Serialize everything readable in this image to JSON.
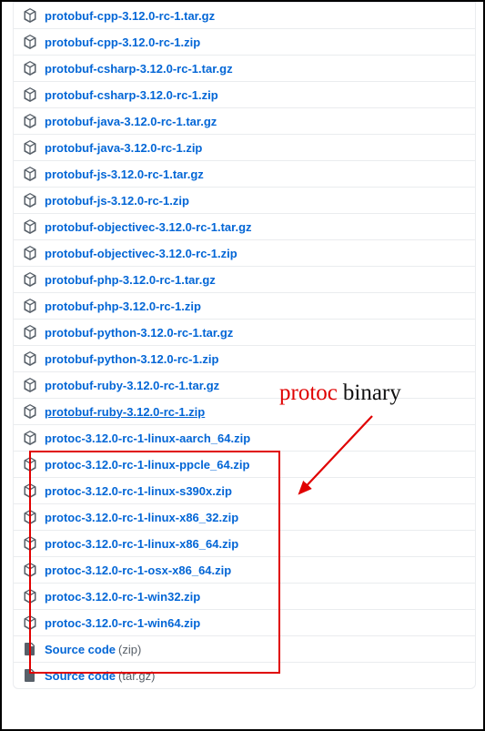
{
  "assets": [
    {
      "name": "protobuf-cpp-3.12.0-rc-1.tar.gz",
      "type": "pkg",
      "underlined": false
    },
    {
      "name": "protobuf-cpp-3.12.0-rc-1.zip",
      "type": "pkg",
      "underlined": false
    },
    {
      "name": "protobuf-csharp-3.12.0-rc-1.tar.gz",
      "type": "pkg",
      "underlined": false
    },
    {
      "name": "protobuf-csharp-3.12.0-rc-1.zip",
      "type": "pkg",
      "underlined": false
    },
    {
      "name": "protobuf-java-3.12.0-rc-1.tar.gz",
      "type": "pkg",
      "underlined": false
    },
    {
      "name": "protobuf-java-3.12.0-rc-1.zip",
      "type": "pkg",
      "underlined": false
    },
    {
      "name": "protobuf-js-3.12.0-rc-1.tar.gz",
      "type": "pkg",
      "underlined": false
    },
    {
      "name": "protobuf-js-3.12.0-rc-1.zip",
      "type": "pkg",
      "underlined": false
    },
    {
      "name": "protobuf-objectivec-3.12.0-rc-1.tar.gz",
      "type": "pkg",
      "underlined": false
    },
    {
      "name": "protobuf-objectivec-3.12.0-rc-1.zip",
      "type": "pkg",
      "underlined": false
    },
    {
      "name": "protobuf-php-3.12.0-rc-1.tar.gz",
      "type": "pkg",
      "underlined": false
    },
    {
      "name": "protobuf-php-3.12.0-rc-1.zip",
      "type": "pkg",
      "underlined": false
    },
    {
      "name": "protobuf-python-3.12.0-rc-1.tar.gz",
      "type": "pkg",
      "underlined": false
    },
    {
      "name": "protobuf-python-3.12.0-rc-1.zip",
      "type": "pkg",
      "underlined": false
    },
    {
      "name": "protobuf-ruby-3.12.0-rc-1.tar.gz",
      "type": "pkg",
      "underlined": false
    },
    {
      "name": "protobuf-ruby-3.12.0-rc-1.zip",
      "type": "pkg",
      "underlined": true
    },
    {
      "name": "protoc-3.12.0-rc-1-linux-aarch_64.zip",
      "type": "pkg",
      "underlined": false
    },
    {
      "name": "protoc-3.12.0-rc-1-linux-ppcle_64.zip",
      "type": "pkg",
      "underlined": false
    },
    {
      "name": "protoc-3.12.0-rc-1-linux-s390x.zip",
      "type": "pkg",
      "underlined": false
    },
    {
      "name": "protoc-3.12.0-rc-1-linux-x86_32.zip",
      "type": "pkg",
      "underlined": false
    },
    {
      "name": "protoc-3.12.0-rc-1-linux-x86_64.zip",
      "type": "pkg",
      "underlined": false
    },
    {
      "name": "protoc-3.12.0-rc-1-osx-x86_64.zip",
      "type": "pkg",
      "underlined": false
    },
    {
      "name": "protoc-3.12.0-rc-1-win32.zip",
      "type": "pkg",
      "underlined": false
    },
    {
      "name": "protoc-3.12.0-rc-1-win64.zip",
      "type": "pkg",
      "underlined": false
    },
    {
      "name": "Source code",
      "suffix": "(zip)",
      "type": "src",
      "underlined": false
    },
    {
      "name": "Source code",
      "suffix": "(tar.gz)",
      "type": "src",
      "underlined": false
    }
  ],
  "annotation": {
    "protoc": "protoc",
    "binary": "binary"
  }
}
